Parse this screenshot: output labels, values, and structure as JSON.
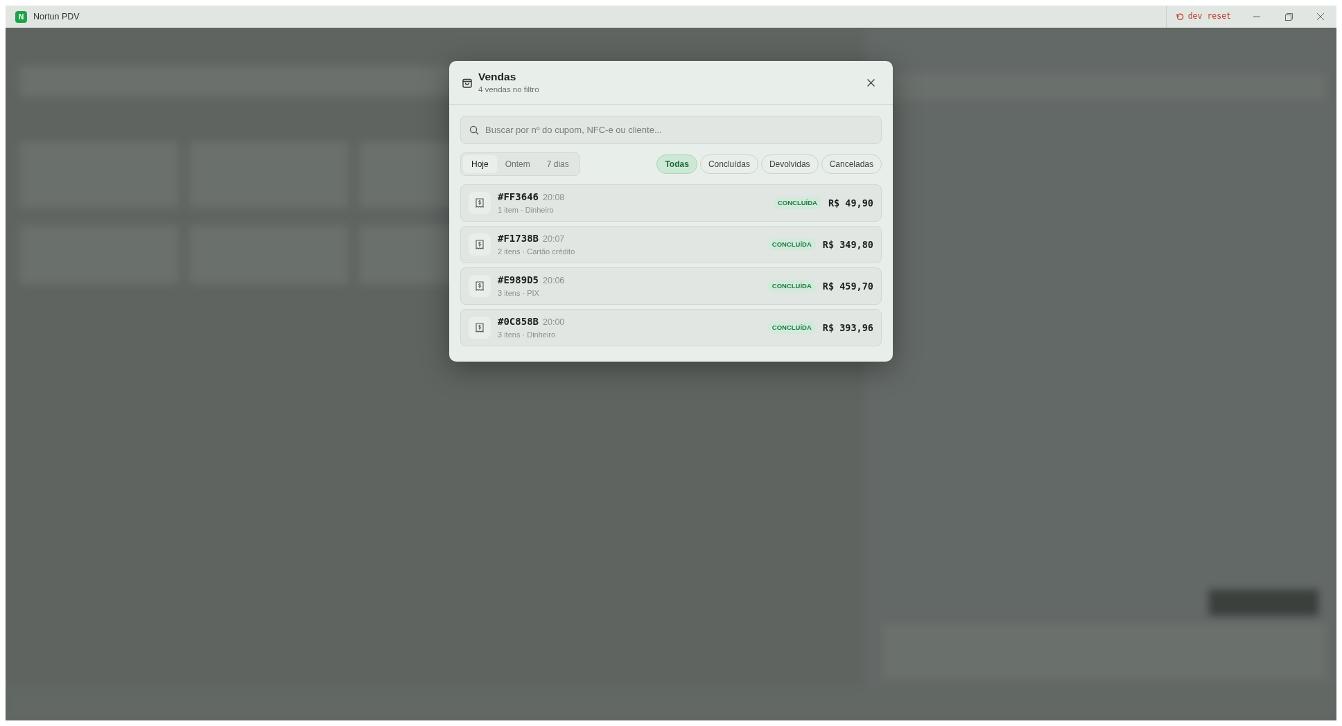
{
  "window": {
    "logo": "N",
    "title": "Nortun PDV",
    "dev_action": "dev reset"
  },
  "dialog": {
    "title": "Vendas",
    "subtitle": "4 vendas no filtro",
    "search": {
      "placeholder": "Buscar por nº do cupom, NFC-e ou cliente..."
    },
    "periods": [
      {
        "label": "Hoje",
        "selected": true
      },
      {
        "label": "Ontem",
        "selected": false
      },
      {
        "label": "7 dias",
        "selected": false
      }
    ],
    "filters": [
      {
        "label": "Todas",
        "selected": true
      },
      {
        "label": "Concluídas",
        "selected": false
      },
      {
        "label": "Devolvidas",
        "selected": false
      },
      {
        "label": "Canceladas",
        "selected": false
      }
    ],
    "sales": [
      {
        "code": "#FF3646",
        "time": "20:08",
        "details": "1 item · Dinheiro",
        "status": "CONCLUÍDA",
        "total": "R$ 49,90"
      },
      {
        "code": "#F1738B",
        "time": "20:07",
        "details": "2 itens · Cartão crédito",
        "status": "CONCLUÍDA",
        "total": "R$ 349,80"
      },
      {
        "code": "#E989D5",
        "time": "20:06",
        "details": "3 itens · PIX",
        "status": "CONCLUÍDA",
        "total": "R$ 459,70"
      },
      {
        "code": "#0C858B",
        "time": "20:00",
        "details": "3 itens · Dinheiro",
        "status": "CONCLUÍDA",
        "total": "R$ 393,96"
      }
    ]
  }
}
